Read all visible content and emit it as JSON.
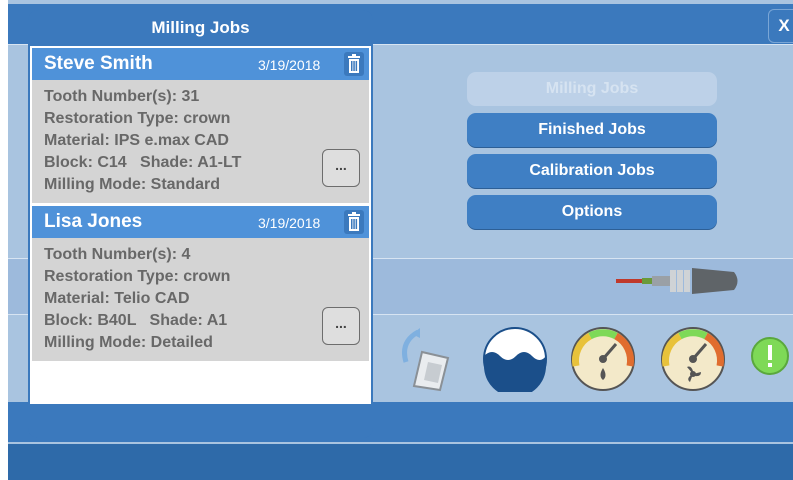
{
  "window": {
    "close_label": "X"
  },
  "panel": {
    "title": "Milling Jobs",
    "jobs": [
      {
        "name": "Steve Smith",
        "date": "3/19/2018",
        "lines": [
          "Tooth Number(s): 31",
          "Restoration Type: crown",
          "Material: IPS e.max CAD",
          "Block: C14   Shade: A1-LT",
          "Milling Mode: Standard"
        ],
        "more_label": "..."
      },
      {
        "name": "Lisa Jones",
        "date": "3/19/2018",
        "lines": [
          "Tooth Number(s): 4",
          "Restoration Type: crown",
          "Material: Telio CAD",
          "Block: B40L   Shade: A1",
          "Milling Mode: Detailed"
        ],
        "more_label": "..."
      }
    ]
  },
  "menu": {
    "milling_jobs": "Milling Jobs",
    "finished_jobs": "Finished Jobs",
    "calibration_jobs": "Calibration Jobs",
    "options": "Options"
  },
  "icons": {
    "tool": "milling-tool-icon",
    "chamber": "chamber-door-icon",
    "water": "water-level-icon",
    "pressure": "pressure-gauge-icon",
    "fan": "fan-gauge-icon",
    "status": "status-indicator-icon"
  },
  "colors": {
    "accent": "#3b79bd",
    "job_header": "#4f92d9",
    "status_green": "#7ed957"
  }
}
